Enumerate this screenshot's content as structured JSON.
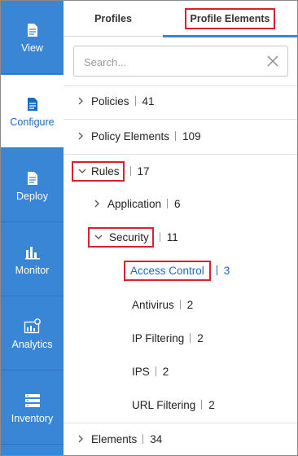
{
  "nav": {
    "items": [
      {
        "label": "View",
        "icon": "document-icon",
        "active": false
      },
      {
        "label": "Configure",
        "icon": "document-icon",
        "active": true
      },
      {
        "label": "Deploy",
        "icon": "document-icon",
        "active": false
      },
      {
        "label": "Monitor",
        "icon": "bar-chart-icon",
        "active": false
      },
      {
        "label": "Analytics",
        "icon": "analytics-icon",
        "active": false
      },
      {
        "label": "Inventory",
        "icon": "server-icon",
        "active": false
      }
    ]
  },
  "tabs": {
    "profiles": "Profiles",
    "profile_elements": "Profile Elements"
  },
  "search": {
    "placeholder": "Search...",
    "value": ""
  },
  "tree": {
    "policies": {
      "label": "Policies",
      "count": "41"
    },
    "policy_elements": {
      "label": "Policy Elements",
      "count": "109"
    },
    "rules": {
      "label": "Rules",
      "count": "17"
    },
    "application": {
      "label": "Application",
      "count": "6"
    },
    "security": {
      "label": "Security",
      "count": "11"
    },
    "access_control": {
      "label": "Access Control",
      "count": "3"
    },
    "antivirus": {
      "label": "Antivirus",
      "count": "2"
    },
    "ip_filtering": {
      "label": "IP Filtering",
      "count": "2"
    },
    "ips": {
      "label": "IPS",
      "count": "2"
    },
    "url_filtering": {
      "label": "URL Filtering",
      "count": "2"
    },
    "elements": {
      "label": "Elements",
      "count": "34"
    }
  },
  "colors": {
    "nav_bg": "#3a86d6",
    "accent": "#1a6ac0",
    "highlight_box": "#d6232d"
  }
}
